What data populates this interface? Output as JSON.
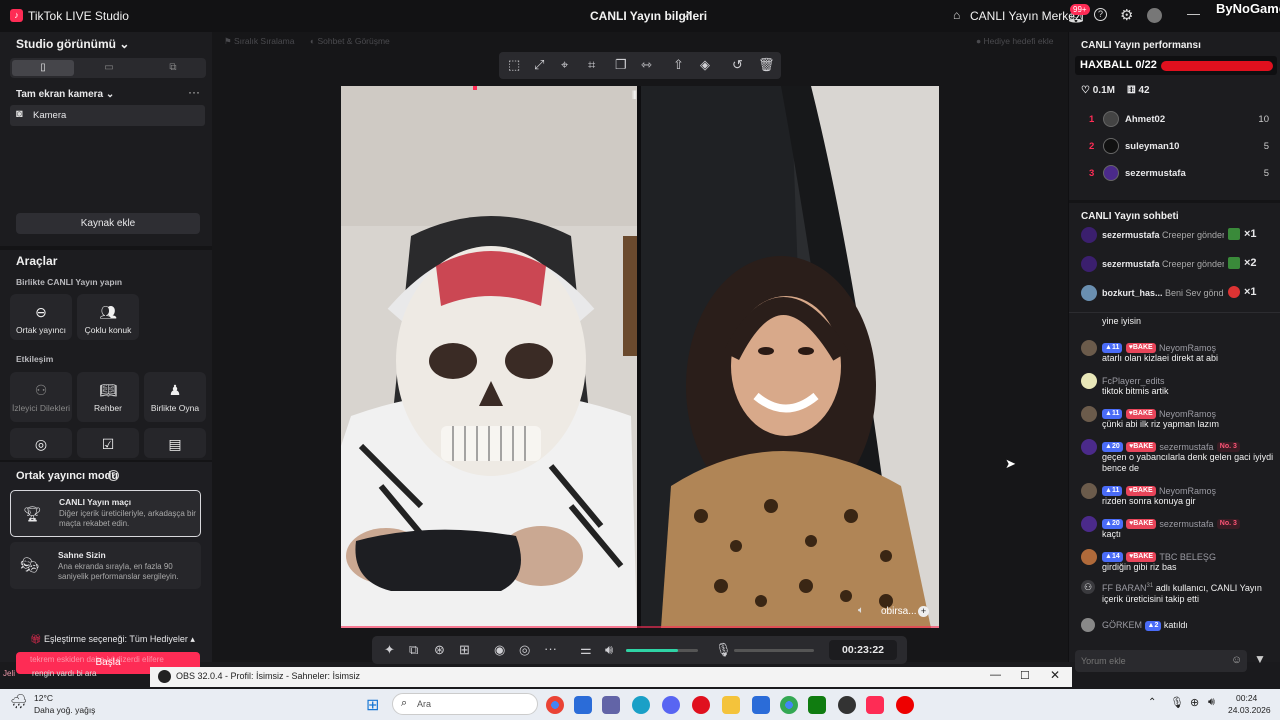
{
  "app": {
    "title": "TikTok LIVE Studio",
    "stream_info": "CANLI Yayın bilgileri",
    "center_link": "CANLI Yayın Merkezi",
    "notif_count": "99+",
    "watermark": "ByNoGame"
  },
  "left": {
    "studio_view": "Studio görünümü",
    "camera_header": "Tam ekran kamera",
    "camera_item": "Kamera",
    "add_source": "Kaynak ekle",
    "tools": "Araçlar",
    "together_live": "Birlikte CANLI Yayın yapın",
    "co_host": "Ortak yayıncı",
    "multi_guest": "Çoklu konuk",
    "interaction": "Etkileşim",
    "viewer_requests": "İzleyici Dilekleri",
    "guide": "Rehber",
    "play_together": "Birlikte Oyna",
    "co_host_mode": "Ortak yayıncı modu",
    "match_title": "CANLI Yayın maçı",
    "match_desc": "Diğer içerik üreticileriyle, arkadaşça bir maçta rekabet edin.",
    "stage_title": "Sahne Sizin",
    "stage_desc": "Ana ekranda sırayla, en fazla 90 saniyelik performanslar sergileyin.",
    "match_option": "Eşleştirme seçeneği: Tüm Hediyeler",
    "start": "Başla",
    "overlay_line1": "tekrem eskiden daha iyi dizerdi elifere",
    "overlay_line2_a": "Jeli",
    "overlay_line2_b": "rengin vardı bi ara"
  },
  "center": {
    "top_left_a": "Sıralık Sıralama",
    "top_left_b": "Sohbet & Görüşme",
    "top_right": "Hediye hedefi ekle",
    "guest_name": "obirsa...",
    "timer": "00:23:22",
    "volume_pct": 0.72
  },
  "right": {
    "perf_title": "CANLI Yayın performansı",
    "goal": "HAXBALL 0/22",
    "likes": "0.1M",
    "gifts": "42",
    "ranking": [
      {
        "rank": "1",
        "name": "Ahmet02",
        "score": "10"
      },
      {
        "rank": "2",
        "name": "suleyman10",
        "score": "5"
      },
      {
        "rank": "3",
        "name": "sezermustafa",
        "score": "5"
      }
    ],
    "chat_title": "CANLI Yayın sohbeti",
    "gift_events": [
      {
        "name": "sezermustafa",
        "text": "Creeper gönder",
        "count": "×1"
      },
      {
        "name": "sezermustafa",
        "text": "Creeper gönder",
        "count": "×2"
      },
      {
        "name": "bozkurt_has...",
        "text": "Beni Sev gönd",
        "count": "×1"
      }
    ],
    "chat": [
      {
        "name": "",
        "lvl": "",
        "team": "",
        "extra": "",
        "msg": "yine iyisin"
      },
      {
        "name": "NeyomRamoş",
        "lvl": "11",
        "team": "BAKE",
        "extra": "",
        "msg": "atarlı olan kizlaei direkt at abi"
      },
      {
        "name": "FcPlayerr_edits",
        "lvl": "",
        "team": "",
        "extra": "",
        "msg": "tiktok bitmis artik"
      },
      {
        "name": "NeyomRamoş",
        "lvl": "11",
        "team": "BAKE",
        "extra": "",
        "msg": "çünki abi ilk riz yapman lazım"
      },
      {
        "name": "sezermustafa",
        "lvl": "20",
        "team": "BAKE",
        "extra": "No. 3",
        "msg": "geçen o yabancılarla denk gelen gaci iyiydi bence de"
      },
      {
        "name": "NeyomRamoş",
        "lvl": "11",
        "team": "BAKE",
        "extra": "",
        "msg": "rizden sonra konuya gir"
      },
      {
        "name": "sezermustafa",
        "lvl": "20",
        "team": "BAKE",
        "extra": "No. 3",
        "msg": "kaçtı"
      },
      {
        "name": "TBC BELEŞG",
        "lvl": "14",
        "team": "BAKE",
        "extra": "",
        "msg": "girdiğin gibi riz bas"
      }
    ],
    "follow_name": "FF BARAN",
    "follow_sup": "31",
    "follow_text": "adlı kullanıcı, CANLI Yayın içerik üreticisini takip etti",
    "join_name": "GÖRKEM",
    "join_lvl": "2",
    "join_text": "katıldı",
    "comment_placeholder": "Yorum ekle"
  },
  "obs": {
    "title": "OBS 32.0.4 - Profil: İsimsiz - Sahneler: İsimsiz"
  },
  "taskbar": {
    "temp": "12°C",
    "weather": "Daha yoğ. yağış",
    "search": "Ara",
    "time": "00:24",
    "date": "24.03.2026"
  },
  "colors": {
    "accent": "#fe2c55",
    "goal_bar": "#e0101e",
    "lvl_badge": "#4a6cf7",
    "team_badge": "#e8455a"
  }
}
